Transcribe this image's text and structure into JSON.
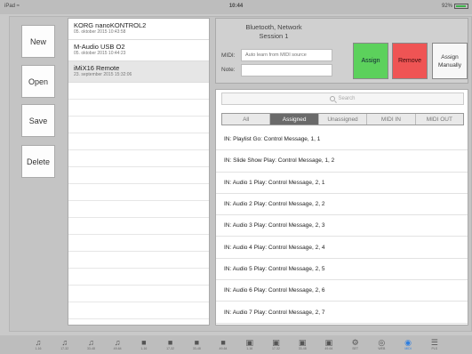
{
  "statusbar": {
    "carrier": "iPad ≈",
    "time": "10:44",
    "battery": "92%"
  },
  "sidebar": {
    "new": "New",
    "open": "Open",
    "save": "Save",
    "delete": "Delete"
  },
  "presets": [
    {
      "name": "KORG nanoKONTROL2",
      "date": "05. oktober 2015 10:43:58",
      "selected": false
    },
    {
      "name": "M-Audio USB O2",
      "date": "05. oktober 2015 10:44:23",
      "selected": false
    },
    {
      "name": "iMiX16 Remote",
      "date": "23. september 2015 15:32:06",
      "selected": true
    }
  ],
  "device": {
    "connection": "Bluetooth, Network",
    "session": "Session 1"
  },
  "midi": {
    "label": "MIDI:",
    "placeholder": "Auto learn from MIDI source"
  },
  "note": {
    "label": "Note:",
    "value": ""
  },
  "buttons": {
    "assign": "Assign",
    "remove": "Remove",
    "assign_manually": "Assign Manually"
  },
  "search": {
    "placeholder": "Search"
  },
  "filter_tabs": [
    "All",
    "Assigned",
    "Unassigned",
    "MIDI IN",
    "MIDI OUT"
  ],
  "active_tab": "Assigned",
  "assignments": [
    "IN: Playlist Go: Control Message, 1, 1",
    "IN: Slide Show Play: Control Message, 1, 2",
    "IN: Audio 1 Play: Control Message, 2, 1",
    "IN: Audio 2 Play: Control Message, 2, 2",
    "IN: Audio 3 Play: Control Message, 2, 3",
    "IN: Audio 4 Play: Control Message, 2, 4",
    "IN: Audio 5 Play: Control Message, 2, 5",
    "IN: Audio 6 Play: Control Message, 2, 6",
    "IN: Audio 7 Play: Control Message, 2, 7"
  ],
  "bottom_tabs": [
    {
      "icon": "music-note-icon",
      "label": "1-16"
    },
    {
      "icon": "music-note-icon",
      "label": "17-32"
    },
    {
      "icon": "music-note-icon",
      "label": "33-48"
    },
    {
      "icon": "music-note-icon",
      "label": "49-64"
    },
    {
      "icon": "video-camera-icon",
      "label": "1-16"
    },
    {
      "icon": "video-camera-icon",
      "label": "17-32"
    },
    {
      "icon": "video-camera-icon",
      "label": "33-48"
    },
    {
      "icon": "video-camera-icon",
      "label": "49-64"
    },
    {
      "icon": "image-icon",
      "label": "1-16"
    },
    {
      "icon": "image-icon",
      "label": "17-32"
    },
    {
      "icon": "image-icon",
      "label": "33-48"
    },
    {
      "icon": "image-icon",
      "label": "49-64"
    },
    {
      "icon": "settings-icon",
      "label": "SET"
    },
    {
      "icon": "globe-icon",
      "label": "WEB"
    },
    {
      "icon": "midi-icon",
      "label": "MIDI",
      "active": true
    },
    {
      "icon": "playlist-icon",
      "label": "PLS"
    }
  ],
  "colors": {
    "assign": "#5cd15c",
    "remove": "#ef5454",
    "active_tab": "#6a6a6a",
    "accent": "#2f7fe0"
  }
}
